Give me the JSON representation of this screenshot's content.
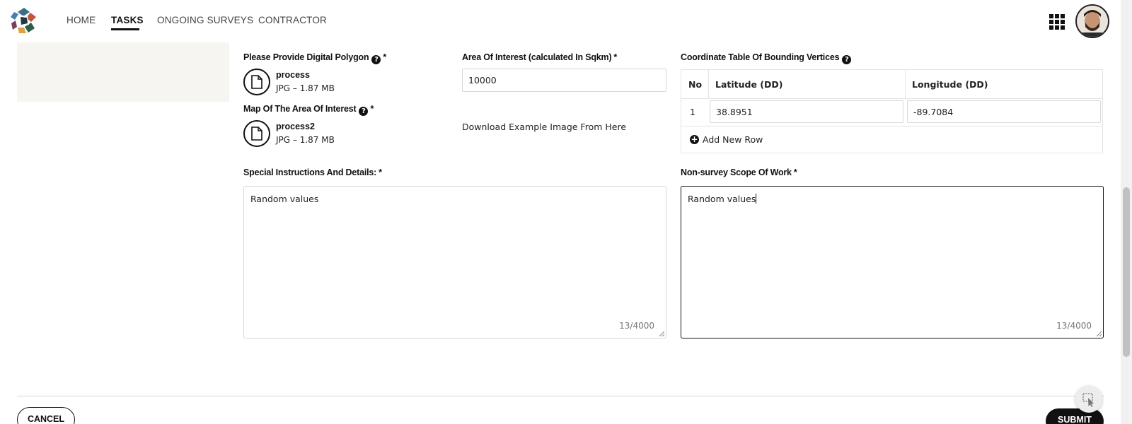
{
  "nav": {
    "items": [
      {
        "label": "HOME"
      },
      {
        "label": "TASKS"
      },
      {
        "label": "ONGOING SURVEYS"
      },
      {
        "label": "CONTRACTOR"
      }
    ],
    "active": "TASKS"
  },
  "form": {
    "digital_polygon": {
      "label": "Please Provide Digital Polygon",
      "required": "*",
      "file": {
        "name": "process",
        "meta": "JPG – 1.87 MB"
      }
    },
    "map_area": {
      "label": "Map Of The Area Of Interest",
      "required": "*",
      "file": {
        "name": "process2",
        "meta": "JPG – 1.87 MB"
      }
    },
    "area_of_interest": {
      "label": "Area Of Interest (calculated In Sqkm)",
      "required": "*",
      "value": "10000"
    },
    "download_link": "Download Example Image From Here",
    "coordinate_table": {
      "label": "Coordinate Table Of Bounding Vertices",
      "headers": [
        "No",
        "Latitude (DD)",
        "Longitude (DD)"
      ],
      "rows": [
        {
          "no": "1",
          "latitude": "38.8951",
          "longitude": "-89.7084"
        }
      ],
      "add_row_label": "Add New Row"
    },
    "special_instructions": {
      "label": "Special Instructions And Details:",
      "required": "*",
      "value": "Random values",
      "count": "13/4000"
    },
    "non_survey_scope": {
      "label": "Non-survey Scope Of Work",
      "required": "*",
      "value": "Random values",
      "count": "13/4000"
    }
  },
  "footer": {
    "cancel_label": "CANCEL",
    "submit_label": "SUBMIT"
  },
  "colors": {
    "primary": "#111111",
    "border": "#d8d8d8",
    "side_card": "#f6f5f2"
  },
  "icons": [
    "app-logo-icon",
    "apps-grid-icon",
    "help-icon",
    "file-icon",
    "plus-circle-icon",
    "select-cursor-icon"
  ]
}
